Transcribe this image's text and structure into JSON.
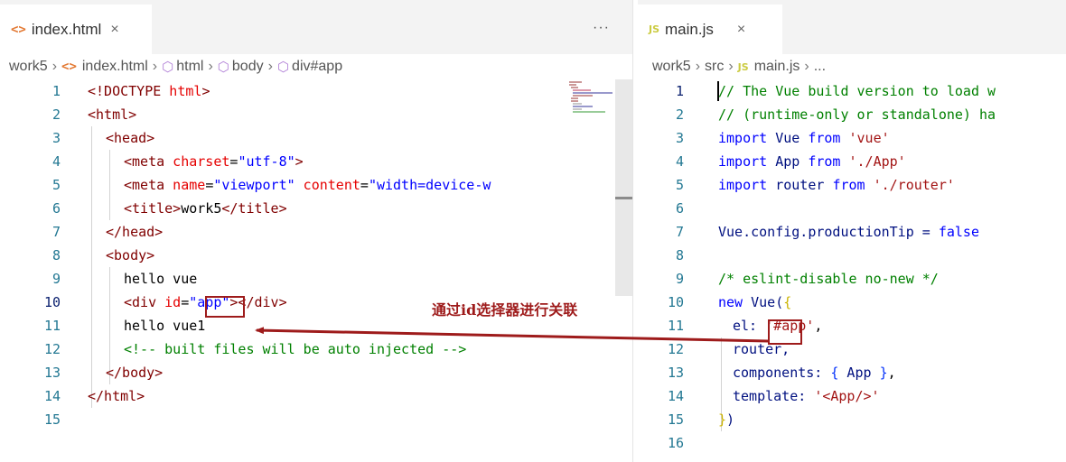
{
  "left": {
    "tab": {
      "icon": "html-file-icon",
      "label": "index.html",
      "close": "×"
    },
    "more": "···",
    "breadcrumb": {
      "root": "work5",
      "file": "index.html",
      "html": "html",
      "body": "body",
      "div": "div#app"
    },
    "lines": [
      {
        "n": "1"
      },
      {
        "n": "2"
      },
      {
        "n": "3"
      },
      {
        "n": "4"
      },
      {
        "n": "5"
      },
      {
        "n": "6"
      },
      {
        "n": "7"
      },
      {
        "n": "8"
      },
      {
        "n": "9"
      },
      {
        "n": "10"
      },
      {
        "n": "11"
      },
      {
        "n": "12"
      },
      {
        "n": "13"
      },
      {
        "n": "14"
      },
      {
        "n": "15"
      }
    ],
    "code": {
      "l1a": "<!DOCTYPE",
      "l1b": " html",
      "l1c": ">",
      "l2": "<html>",
      "l3": "<head>",
      "l4a": "<meta",
      "l4b": " charset",
      "l4c": "=",
      "l4d": "\"utf-8\"",
      "l4e": ">",
      "l5a": "<meta",
      "l5b": " name",
      "l5c": "=",
      "l5d": "\"viewport\"",
      "l5e": " content",
      "l5f": "=",
      "l5g": "\"width=device-w",
      "l6a": "<title>",
      "l6b": "work5",
      "l6c": "</title>",
      "l7": "</head>",
      "l8": "<body>",
      "l9": "hello vue",
      "l10a": "<div",
      "l10b": " id",
      "l10c": "=",
      "l10d": "\"",
      "l10e": "app",
      "l10f": "\"",
      "l10g": "></div>",
      "l11": "hello vue1",
      "l12": "<!-- built files will be auto injected -->",
      "l13": "</body>",
      "l14": "</html>"
    }
  },
  "right": {
    "tab": {
      "icon": "JS",
      "label": "main.js",
      "close": "×"
    },
    "breadcrumb": {
      "root": "work5",
      "src": "src",
      "file": "main.js",
      "rest": "..."
    },
    "lines": [
      {
        "n": "1"
      },
      {
        "n": "2"
      },
      {
        "n": "3"
      },
      {
        "n": "4"
      },
      {
        "n": "5"
      },
      {
        "n": "6"
      },
      {
        "n": "7"
      },
      {
        "n": "8"
      },
      {
        "n": "9"
      },
      {
        "n": "10"
      },
      {
        "n": "11"
      },
      {
        "n": "12"
      },
      {
        "n": "13"
      },
      {
        "n": "14"
      },
      {
        "n": "15"
      },
      {
        "n": "16"
      }
    ],
    "code": {
      "l1": "// The Vue build version to load w",
      "l2": "// (runtime-only or standalone) ha",
      "l3a": "import",
      "l3b": " Vue ",
      "l3c": "from",
      "l3d": " 'vue'",
      "l4a": "import",
      "l4b": " App ",
      "l4c": "from",
      "l4d": " './App'",
      "l5a": "import",
      "l5b": " router ",
      "l5c": "from",
      "l5d": " './router'",
      "l7a": "Vue.config.productionTip = ",
      "l7b": "false",
      "l9": "/* eslint-disable no-new */",
      "l10a": "new",
      "l10b": " Vue(",
      "l10c": "{",
      "l11a": "el: ",
      "l11b": "'#",
      "l11c": "app",
      "l11d": "'",
      "l11e": ",",
      "l12": "router,",
      "l13a": "components: ",
      "l13b": "{",
      "l13c": " App ",
      "l13d": "}",
      "l13e": ",",
      "l14a": "template: ",
      "l14b": "'<App/>'",
      "l15a": "}",
      "l15b": ")"
    }
  },
  "annotation": "通过id选择器进行关联",
  "colors": {
    "annotation": "#9e1b1b",
    "tag": "#800000",
    "attr": "#e50000",
    "string": "#0000ff",
    "comment": "#008000",
    "keyword": "#0000ff",
    "js_string": "#a31515",
    "line_number": "#237893"
  }
}
